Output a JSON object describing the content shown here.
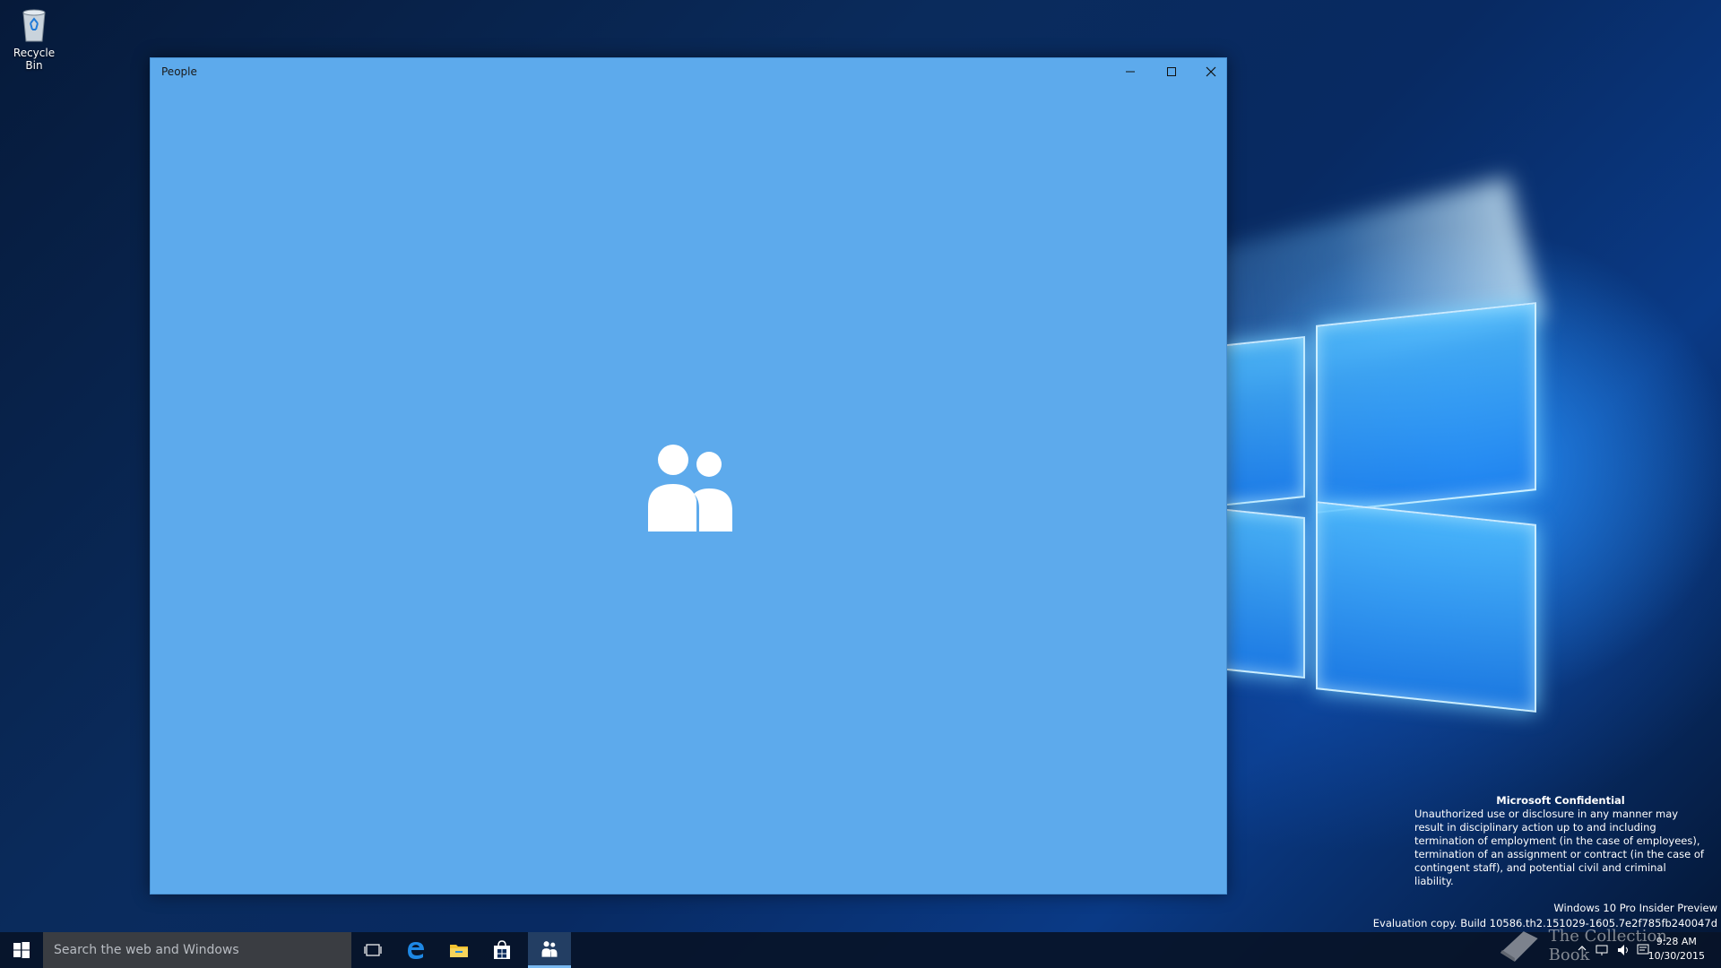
{
  "desktop": {
    "icons": [
      {
        "label": "Recycle Bin"
      }
    ],
    "confidential": {
      "title": "Microsoft Confidential",
      "body": "Unauthorized use or disclosure in any manner may result in disciplinary action up to and including termination of employment (in the case of employees), termination of an assignment or contract (in the case of contingent staff), and potential civil and criminal liability."
    },
    "build": {
      "edition": "Windows 10 Pro Insider Preview",
      "evaluation": "Evaluation copy. Build 10586.th2.151029-1605.7e2f785fb240047d"
    },
    "watermark": "The Collection Book"
  },
  "window": {
    "title": "People",
    "buttons": {
      "minimize": "minimize-icon",
      "maximize": "maximize-icon",
      "close": "close-icon"
    },
    "splash_icon": "people-icon",
    "background_color": "#5daaec"
  },
  "taskbar": {
    "search_placeholder": "Search the web and Windows",
    "pinned": [
      {
        "name": "task-view-icon"
      },
      {
        "name": "edge-icon"
      },
      {
        "name": "file-explorer-icon"
      },
      {
        "name": "store-icon"
      },
      {
        "name": "people-icon",
        "active": true
      }
    ],
    "clock": {
      "time": "9:28 AM",
      "date": "10/30/2015"
    }
  }
}
